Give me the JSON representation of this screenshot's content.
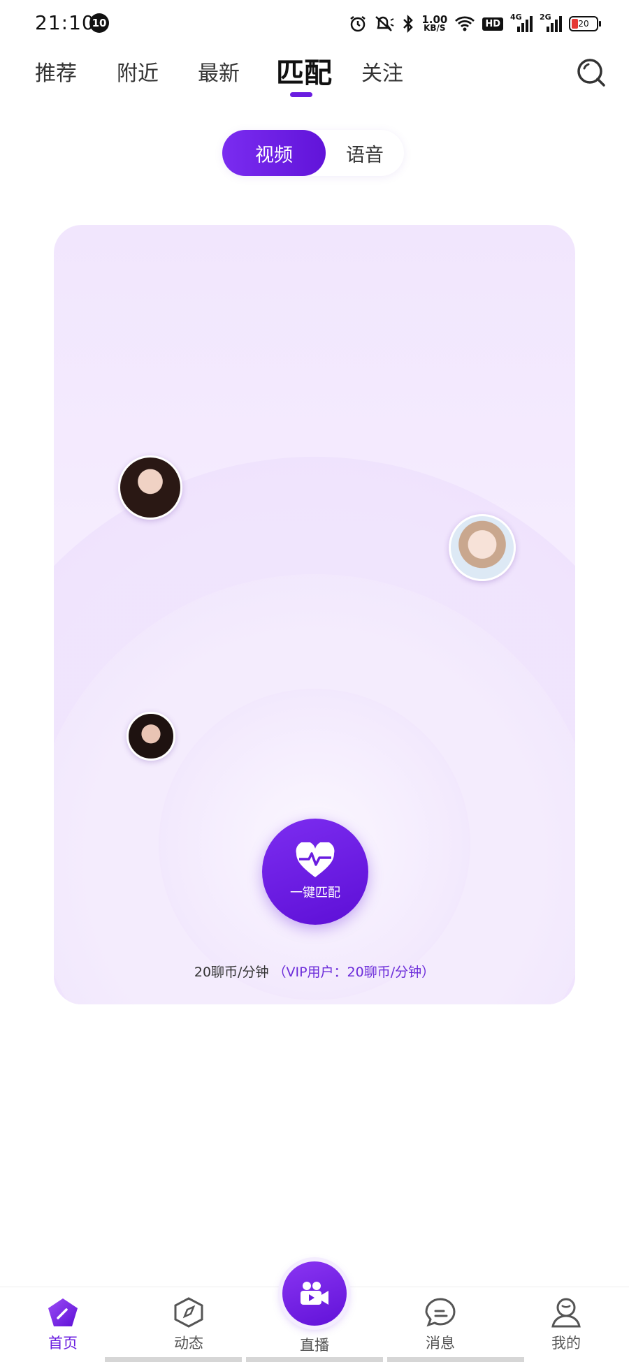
{
  "status_bar": {
    "time": "21:10",
    "notification_count": "10",
    "speed_value": "1.00",
    "speed_unit": "KB/S",
    "hd_label": "HD",
    "network_1": "4G",
    "network_2": "2G",
    "battery": "20"
  },
  "top_tabs": [
    "推荐",
    "附近",
    "最新",
    "匹配",
    "关注"
  ],
  "active_tab": "匹配",
  "mode_toggle": {
    "video": "视频",
    "voice": "语音",
    "selected": "视频"
  },
  "match_card": {
    "button_label": "一键匹配",
    "price_text": "20聊币/分钟",
    "vip_text": "（VIP用户：20聊币/分钟）"
  },
  "bottom_nav": {
    "home": "首页",
    "moments": "动态",
    "live": "直播",
    "messages": "消息",
    "mine": "我的"
  },
  "colors": {
    "accent": "#6a1de0",
    "card_bg": "#f3e9fd"
  }
}
